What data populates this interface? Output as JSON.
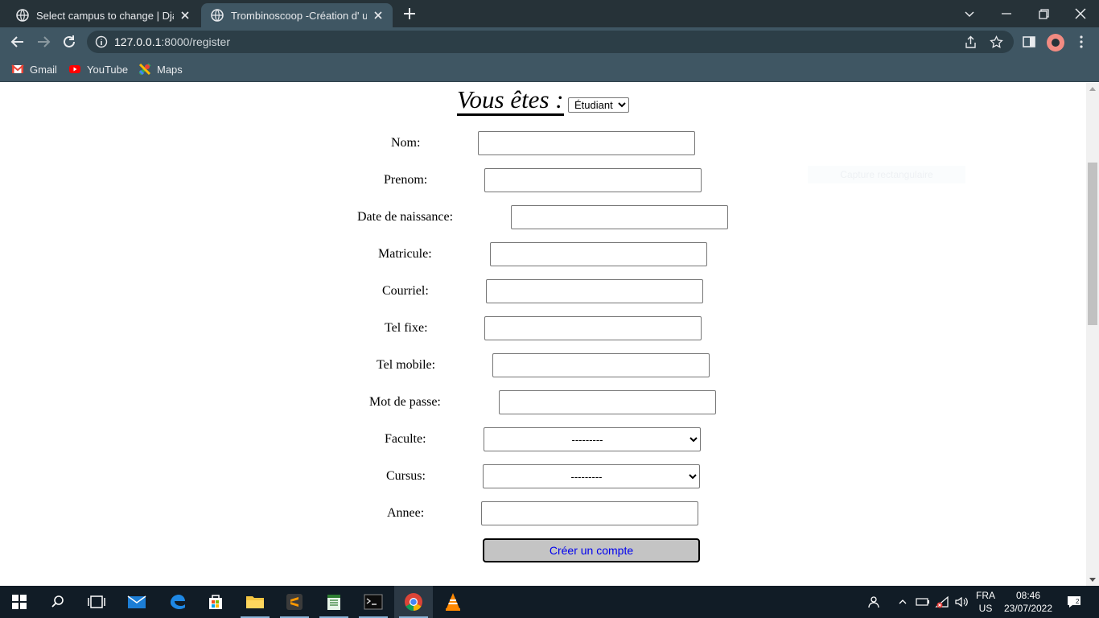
{
  "browser": {
    "tabs": [
      {
        "title": "Select campus to change | Djang",
        "active": false
      },
      {
        "title": "Trombinoscoop -Création d' un p",
        "active": true
      }
    ],
    "address": {
      "host": "127.0.0.1",
      "path": ":8000/register"
    },
    "bookmarks": [
      {
        "label": "Gmail",
        "icon": "gmail-icon"
      },
      {
        "label": "YouTube",
        "icon": "youtube-icon"
      },
      {
        "label": "Maps",
        "icon": "maps-icon"
      }
    ]
  },
  "page": {
    "heading": "Vous êtes :",
    "role_select": {
      "value": "Étudiant"
    },
    "fields": [
      {
        "label": "Nom:"
      },
      {
        "label": "Prenom:"
      },
      {
        "label": "Date de naissance:"
      },
      {
        "label": "Matricule:"
      },
      {
        "label": "Courriel:"
      },
      {
        "label": "Tel fixe:"
      },
      {
        "label": "Tel mobile:"
      },
      {
        "label": "Mot de passe:"
      },
      {
        "label": "Faculte:",
        "value": "---------"
      },
      {
        "label": "Cursus:",
        "value": "---------"
      },
      {
        "label": "Annee:"
      }
    ],
    "submit_label": "Créer un compte",
    "ghost_text": "Capture rectangulaire"
  },
  "taskbar": {
    "lang": {
      "line1": "FRA",
      "line2": "US"
    },
    "clock": {
      "time": "08:46",
      "date": "23/07/2022"
    }
  },
  "colors": {
    "titlebar": "#263238",
    "toolbar": "#3f5663",
    "taskbar": "#111c26",
    "button_bg": "#c4c4c4",
    "button_text": "#0000ee"
  }
}
